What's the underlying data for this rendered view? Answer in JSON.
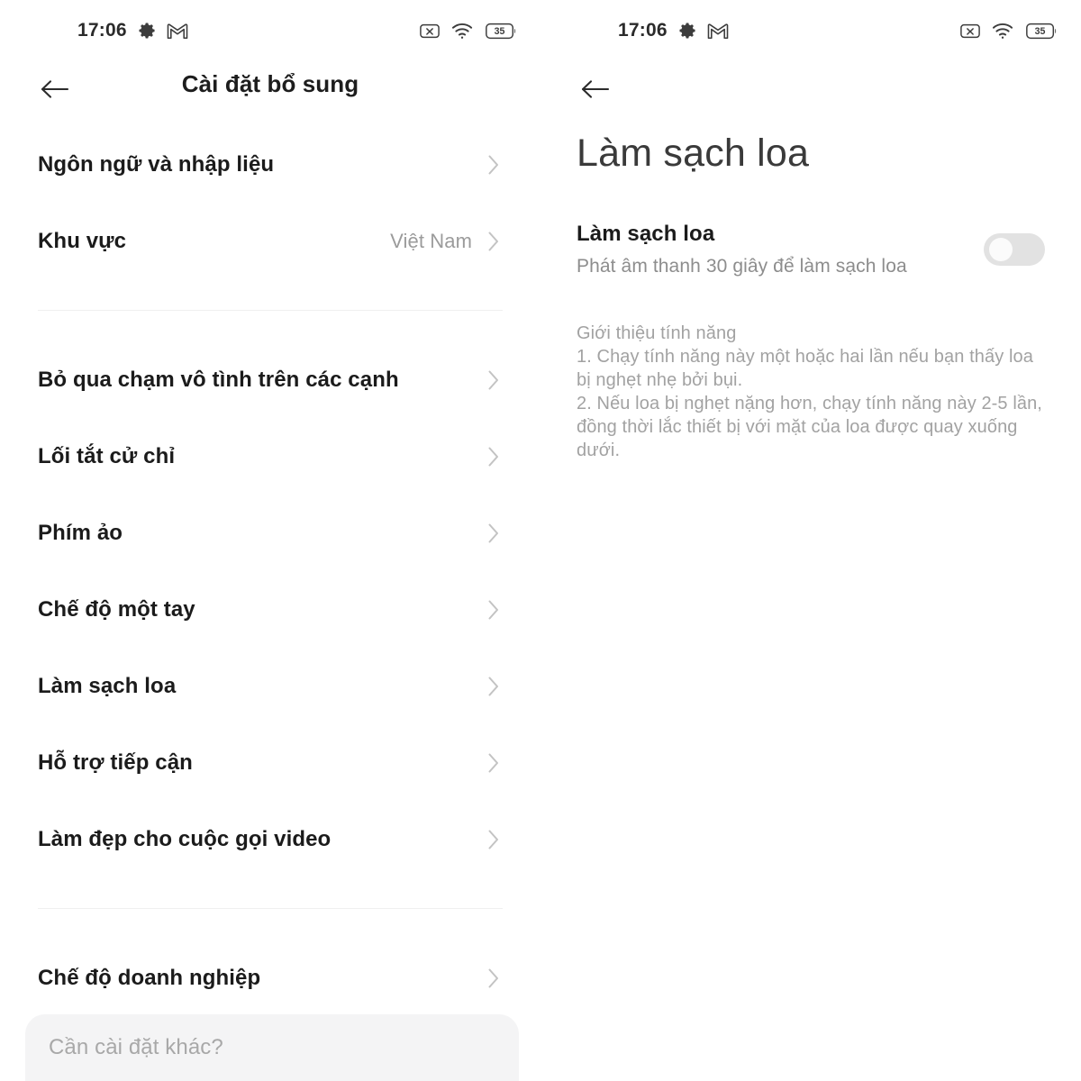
{
  "status_bar": {
    "time": "17:06",
    "left_icons": [
      "gear-icon",
      "gmail-icon"
    ],
    "right_icons": [
      "no-sim-icon",
      "wifi-icon",
      "battery-icon"
    ],
    "battery_level": "35"
  },
  "left_screen": {
    "nav": {
      "back_icon": "back-arrow-icon",
      "title": "Cài đặt bổ sung"
    },
    "groups": [
      {
        "items": [
          {
            "label": "Ngôn ngữ và nhập liệu",
            "value": ""
          },
          {
            "label": "Khu vực",
            "value": "Việt Nam"
          }
        ]
      },
      {
        "items": [
          {
            "label": "Bỏ qua chạm vô tình trên các cạnh",
            "value": ""
          },
          {
            "label": "Lối tắt cử chỉ",
            "value": ""
          },
          {
            "label": "Phím ảo",
            "value": ""
          },
          {
            "label": "Chế độ một tay",
            "value": ""
          },
          {
            "label": "Làm sạch loa",
            "value": ""
          },
          {
            "label": "Hỗ trợ tiếp cận",
            "value": ""
          },
          {
            "label": "Làm đẹp cho cuộc gọi video",
            "value": ""
          }
        ]
      },
      {
        "items": [
          {
            "label": "Chế độ doanh nghiệp",
            "value": ""
          }
        ]
      }
    ],
    "search": {
      "placeholder": "Cần cài đặt khác?"
    }
  },
  "right_screen": {
    "nav": {
      "back_icon": "back-arrow-icon"
    },
    "title": "Làm sạch loa",
    "toggle": {
      "title": "Làm sạch loa",
      "subtitle": "Phát âm thanh 30 giây để làm sạch loa",
      "state": "off"
    },
    "description": {
      "heading": "Giới thiệu tính năng",
      "lines": [
        "1. Chạy tính năng này một hoặc hai lần nếu bạn thấy loa bị nghẹt nhẹ bởi bụi.",
        "2. Nếu loa bị nghẹt nặng hơn, chạy tính năng này 2-5 lần, đồng thời lắc thiết bị với mặt của loa được quay xuống dưới."
      ]
    }
  },
  "colors": {
    "background": "#ffffff",
    "primary_text": "#1b1b1b",
    "secondary_text": "#9b9b9b",
    "divider": "#f0f0f0",
    "sheet_background": "#f4f4f5",
    "switch_off": "#e2e2e2"
  }
}
